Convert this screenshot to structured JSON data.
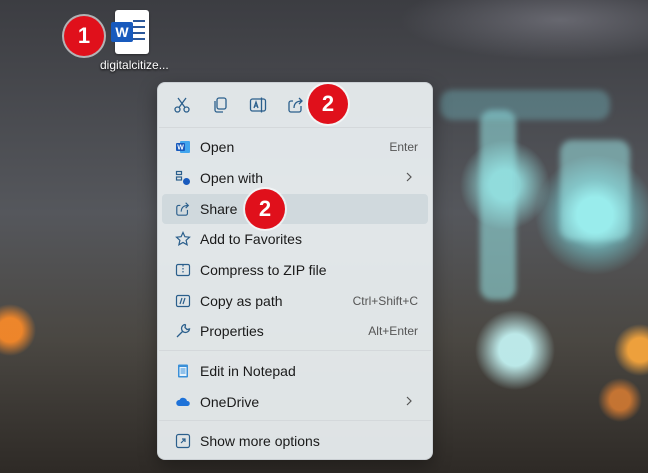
{
  "desktop": {
    "file_label": "digitalcitize...",
    "file_icon": "word-document-icon"
  },
  "callouts": [
    "1",
    "2",
    "2"
  ],
  "toolbar": {
    "buttons": [
      {
        "icon": "cut-icon"
      },
      {
        "icon": "copy-icon"
      },
      {
        "icon": "rename-icon"
      },
      {
        "icon": "share-icon"
      }
    ]
  },
  "menu": {
    "items": [
      {
        "label": "Open",
        "shortcut": "Enter",
        "icon": "word-icon"
      },
      {
        "label": "Open with",
        "icon": "open-with-icon",
        "submenu": true
      },
      {
        "label": "Share",
        "icon": "share-icon"
      },
      {
        "label": "Add to Favorites",
        "icon": "star-icon"
      },
      {
        "label": "Compress to ZIP file",
        "icon": "zip-icon"
      },
      {
        "label": "Copy as path",
        "shortcut": "Ctrl+Shift+C",
        "icon": "copy-path-icon"
      },
      {
        "label": "Properties",
        "shortcut": "Alt+Enter",
        "icon": "wrench-icon"
      },
      {
        "label": "Edit in Notepad",
        "icon": "notepad-icon"
      },
      {
        "label": "OneDrive",
        "icon": "onedrive-icon",
        "submenu": true
      },
      {
        "label": "Show more options",
        "icon": "more-options-icon"
      }
    ]
  },
  "colors": {
    "callout": "#e0101b",
    "accent": "#185abd",
    "menu_bg": "#ecf1f3"
  }
}
